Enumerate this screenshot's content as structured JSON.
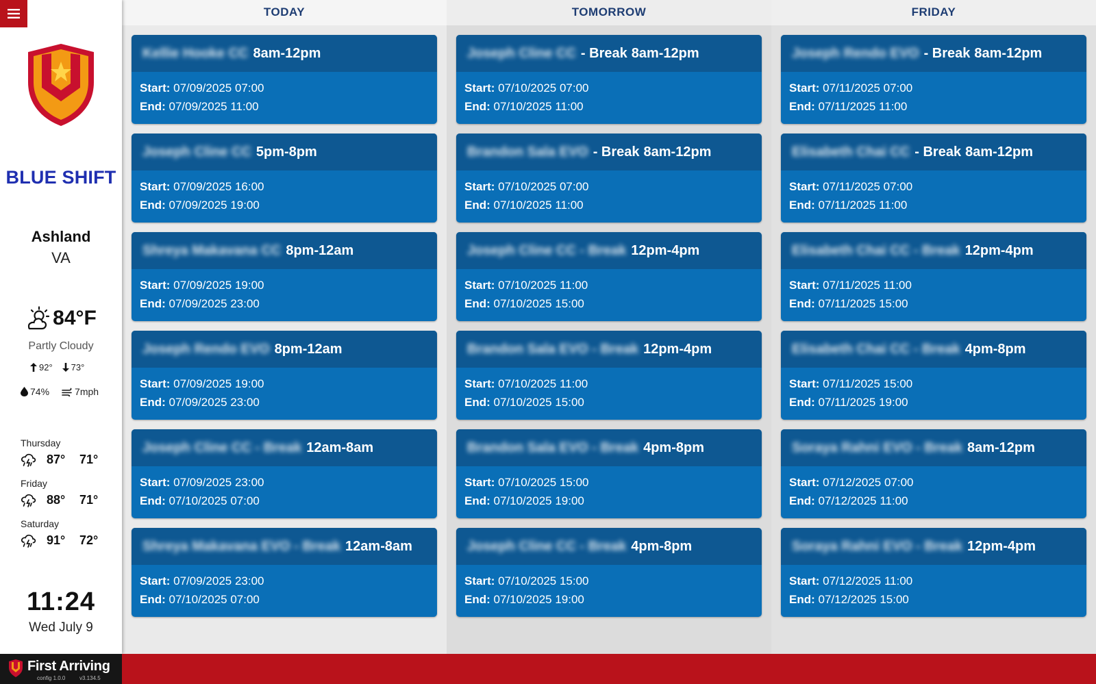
{
  "sidebar": {
    "shift_name": "BLUE SHIFT",
    "city": "Ashland",
    "state": "VA",
    "current": {
      "temp": "84°F",
      "condition": "Partly Cloudy",
      "high": "92°",
      "low": "73°",
      "humidity": "74%",
      "wind": "7mph",
      "icon": "partly-cloudy-icon"
    },
    "forecast": [
      {
        "day": "Thursday",
        "hi": "87°",
        "lo": "71°",
        "icon": "thunderstorm-icon"
      },
      {
        "day": "Friday",
        "hi": "88°",
        "lo": "71°",
        "icon": "thunderstorm-icon"
      },
      {
        "day": "Saturday",
        "hi": "91°",
        "lo": "72°",
        "icon": "thunderstorm-icon"
      }
    ],
    "time": "11:24",
    "date": "Wed July 9"
  },
  "footer": {
    "brand": "First Arriving",
    "config": "config 1.0.0",
    "version": "v3.134.5"
  },
  "labels": {
    "start": "Start:",
    "end": "End:"
  },
  "colors": {
    "brand_red": "#b9121b",
    "card_body": "#0a6fb7",
    "card_header": "#0e5892",
    "shift_blue": "#1f2fb0",
    "column_header_text": "#1e3d73"
  },
  "columns": [
    {
      "title": "TODAY",
      "cards": [
        {
          "name": "Kellie Hooke CC",
          "prefix": "",
          "time": "8am-12pm",
          "start": "07/09/2025 07:00",
          "end": "07/09/2025 11:00"
        },
        {
          "name": "Joseph Cline CC",
          "prefix": "",
          "time": "5pm-8pm",
          "start": "07/09/2025 16:00",
          "end": "07/09/2025 19:00"
        },
        {
          "name": "Shreya Makavana CC",
          "prefix": "",
          "time": "8pm-12am",
          "start": "07/09/2025 19:00",
          "end": "07/09/2025 23:00"
        },
        {
          "name": "Joseph Rendo EVO",
          "prefix": "",
          "time": "8pm-12am",
          "start": "07/09/2025 19:00",
          "end": "07/09/2025 23:00"
        },
        {
          "name": "Joseph Cline CC - Break",
          "prefix": "",
          "time": "12am-8am",
          "start": "07/09/2025 23:00",
          "end": "07/10/2025 07:00"
        },
        {
          "name": "Shreya Makavana EVO - Break",
          "prefix": "",
          "time": "12am-8am",
          "start": "07/09/2025 23:00",
          "end": "07/10/2025 07:00"
        }
      ]
    },
    {
      "title": "TOMORROW",
      "cards": [
        {
          "name": "Joseph Cline CC",
          "prefix": "- Break",
          "time": "8am-12pm",
          "start": "07/10/2025 07:00",
          "end": "07/10/2025 11:00"
        },
        {
          "name": "Brandon Sala EVO",
          "prefix": "- Break",
          "time": "8am-12pm",
          "start": "07/10/2025 07:00",
          "end": "07/10/2025 11:00"
        },
        {
          "name": "Joseph Cline CC - Break",
          "prefix": "",
          "time": "12pm-4pm",
          "start": "07/10/2025 11:00",
          "end": "07/10/2025 15:00"
        },
        {
          "name": "Brandon Sala EVO - Break",
          "prefix": "",
          "time": "12pm-4pm",
          "start": "07/10/2025 11:00",
          "end": "07/10/2025 15:00"
        },
        {
          "name": "Brandon Sala EVO - Break",
          "prefix": "",
          "time": "4pm-8pm",
          "start": "07/10/2025 15:00",
          "end": "07/10/2025 19:00"
        },
        {
          "name": "Joseph Cline CC - Break",
          "prefix": "",
          "time": "4pm-8pm",
          "start": "07/10/2025 15:00",
          "end": "07/10/2025 19:00"
        }
      ]
    },
    {
      "title": "FRIDAY",
      "cards": [
        {
          "name": "Joseph Rendo EVO",
          "prefix": "- Break",
          "time": "8am-12pm",
          "start": "07/11/2025 07:00",
          "end": "07/11/2025 11:00"
        },
        {
          "name": "Elisabeth Chai CC",
          "prefix": "- Break",
          "time": "8am-12pm",
          "start": "07/11/2025 07:00",
          "end": "07/11/2025 11:00"
        },
        {
          "name": "Elisabeth Chai CC - Break",
          "prefix": "",
          "time": "12pm-4pm",
          "start": "07/11/2025 11:00",
          "end": "07/11/2025 15:00"
        },
        {
          "name": "Elisabeth Chai CC - Break",
          "prefix": "",
          "time": "4pm-8pm",
          "start": "07/11/2025 15:00",
          "end": "07/11/2025 19:00"
        },
        {
          "name": "Soraya Rahni EVO - Break",
          "prefix": "",
          "time": "8am-12pm",
          "start": "07/12/2025 07:00",
          "end": "07/12/2025 11:00"
        },
        {
          "name": "Soraya Rahni EVO - Break",
          "prefix": "",
          "time": "12pm-4pm",
          "start": "07/12/2025 11:00",
          "end": "07/12/2025 15:00"
        }
      ]
    }
  ]
}
